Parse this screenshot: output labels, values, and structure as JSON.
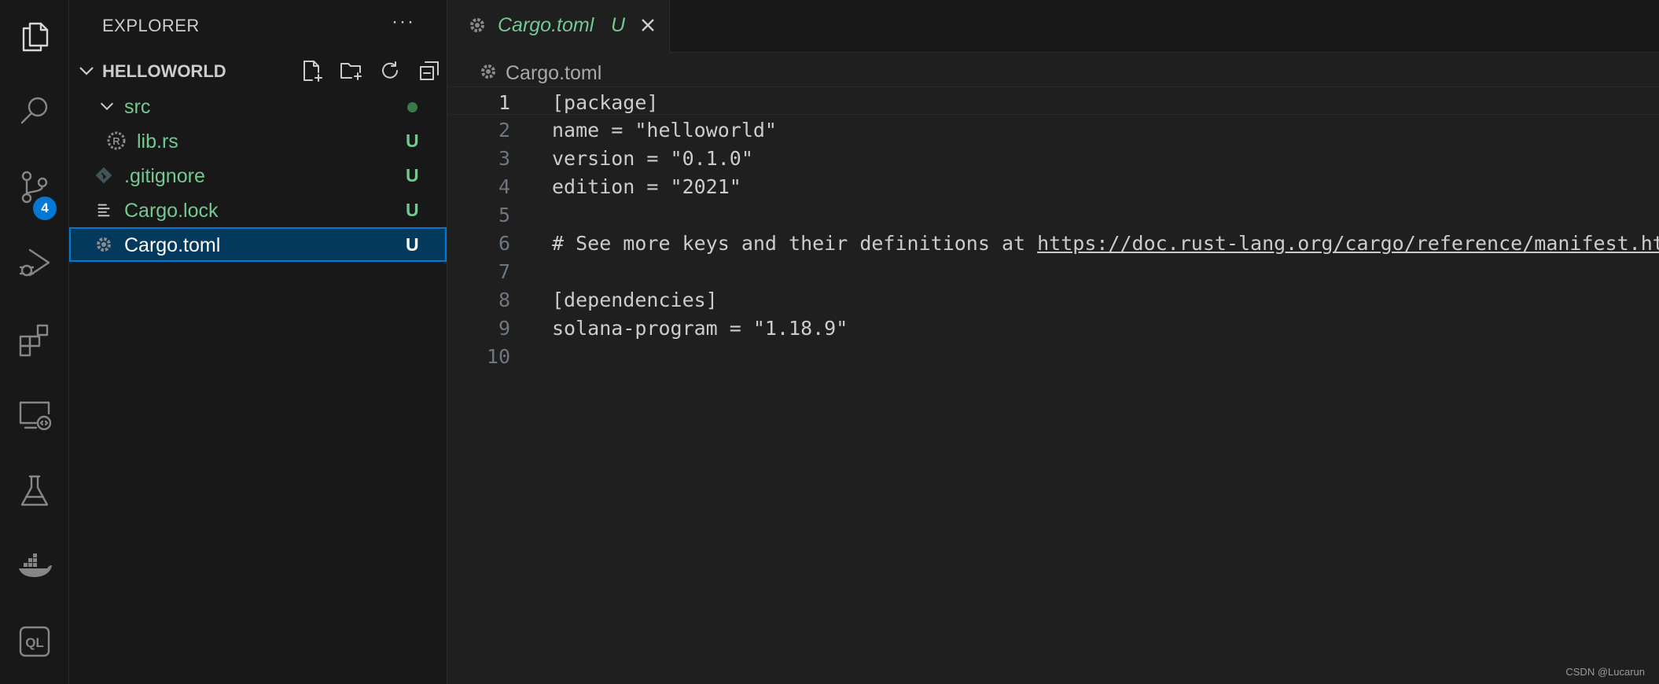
{
  "activity_bar": {
    "items": [
      "explorer-icon",
      "search-icon",
      "source-control-icon",
      "run-debug-icon",
      "extensions-icon",
      "remote-explorer-icon",
      "testing-icon",
      "docker-icon",
      "codeql-icon"
    ],
    "scm_badge": "4"
  },
  "sidebar": {
    "title": "EXPLORER",
    "more_label": "···",
    "section_title": "HELLOWORLD",
    "tree": [
      {
        "label": "src",
        "badge": "",
        "kind": "folder"
      },
      {
        "label": "lib.rs",
        "badge": "U",
        "kind": "rust"
      },
      {
        "label": ".gitignore",
        "badge": "U",
        "kind": "git"
      },
      {
        "label": "Cargo.lock",
        "badge": "U",
        "kind": "lock"
      },
      {
        "label": "Cargo.toml",
        "badge": "U",
        "kind": "toml"
      }
    ]
  },
  "editor": {
    "tab": {
      "label": "Cargo.toml",
      "badge": "U"
    },
    "breadcrumb": "Cargo.toml",
    "lines": [
      {
        "n": "1",
        "text": "[package]"
      },
      {
        "n": "2",
        "text": "name = \"helloworld\""
      },
      {
        "n": "3",
        "text": "version = \"0.1.0\""
      },
      {
        "n": "4",
        "text": "edition = \"2021\""
      },
      {
        "n": "5",
        "text": ""
      },
      {
        "n": "6",
        "text": "# See more keys and their definitions at "
      },
      {
        "n": "7",
        "text": ""
      },
      {
        "n": "8",
        "text": "[dependencies]"
      },
      {
        "n": "9",
        "text": "solana-program = \"1.18.9\""
      },
      {
        "n": "10",
        "text": ""
      }
    ],
    "link": "https://doc.rust-lang.org/cargo/reference/manifest.html"
  },
  "watermark": "CSDN @Lucarun",
  "colors": {
    "accent": "#0078d4",
    "untracked": "#73c991",
    "selection": "#04395e"
  }
}
